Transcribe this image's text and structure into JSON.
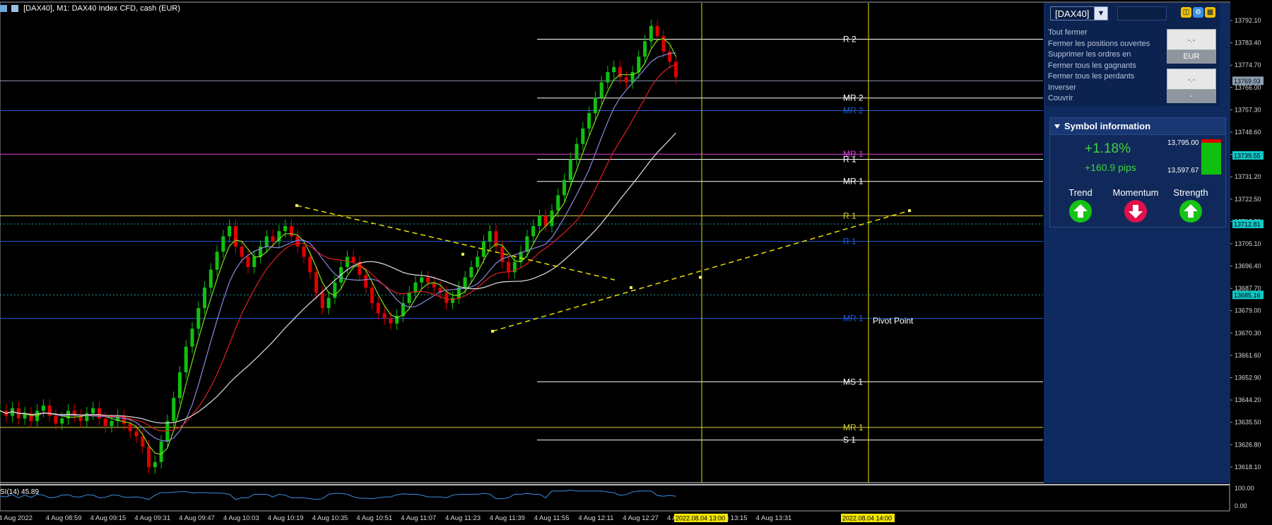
{
  "header": {
    "title": "[DAX40], M1:  DAX40 Index CFD, cash (EUR)"
  },
  "chart_data": {
    "type": "candlestick",
    "symbol": "DAX40",
    "timeframe": "M1",
    "ylim": [
      13612,
      13799
    ],
    "y_ticks": [
      13792.1,
      13783.4,
      13774.7,
      13766.0,
      13757.3,
      13748.6,
      13739.9,
      13731.2,
      13722.5,
      13713.8,
      13705.1,
      13696.4,
      13687.7,
      13679.0,
      13670.3,
      13661.6,
      13652.9,
      13644.2,
      13635.5,
      13626.8,
      13618.1
    ],
    "price_tags": [
      {
        "label": "13769.03",
        "value": 13768.6,
        "color": "#8fa0b4"
      },
      {
        "label": "13739.55",
        "value": 13739.55,
        "color": "#13c8c8"
      },
      {
        "label": "13712.81",
        "value": 13712.81,
        "color": "#13c8c8"
      },
      {
        "label": "13685.16",
        "value": 13685.16,
        "color": "#13c8c8"
      }
    ],
    "x_labels": [
      "4 Aug 2022",
      "4 Aug 08:59",
      "4 Aug 09:15",
      "4 Aug 09:31",
      "4 Aug 09:47",
      "4 Aug 10:03",
      "4 Aug 10:19",
      "4 Aug 10:35",
      "4 Aug 10:51",
      "4 Aug 11:07",
      "4 Aug 11:23",
      "4 Aug 11:39",
      "4 Aug 11:55",
      "4 Aug 12:11",
      "4 Aug 12:27",
      "4 Aug",
      "4 Aug 13:15",
      "4 Aug 13:31"
    ],
    "time_markers": [
      "2022.08.04 13:00",
      "2022.08.04 14:00"
    ],
    "pivot_levels": [
      {
        "name": "R 2",
        "value": 13784.8,
        "color": "#ffffff"
      },
      {
        "name": "MR 2",
        "value": 13761.9,
        "color": "#ffffff"
      },
      {
        "name": "MR 2",
        "value": 13757.0,
        "color": "#1f5bd9"
      },
      {
        "name": "MR 1",
        "value": 13740.0,
        "color": "#e040e0"
      },
      {
        "name": "R 1",
        "value": 13738.0,
        "color": "#ffffff"
      },
      {
        "name": "MR 1",
        "value": 13729.4,
        "color": "#ffffff"
      },
      {
        "name": "R 1",
        "value": 13716.0,
        "color": "#d8d33a"
      },
      {
        "name": "R 1",
        "value": 13706.0,
        "color": "#1f5bd9"
      },
      {
        "name": "MR 1",
        "value": 13676.0,
        "color": "#1f5bd9"
      },
      {
        "name": "MS 1",
        "value": 13651.3,
        "color": "#ffffff"
      },
      {
        "name": "MR 1",
        "value": 13633.5,
        "color": "#d8d33a"
      },
      {
        "name": "S 1",
        "value": 13628.6,
        "color": "#ffffff"
      }
    ],
    "pivot_point_label": "Pivot Point",
    "rsi": {
      "label": "SI(14) 45.89",
      "value": 45.89,
      "ticks": [
        "100.00",
        "0.00"
      ]
    },
    "series_close": [
      13640,
      13638,
      13641,
      13637,
      13639,
      13636,
      13640,
      13642,
      13638,
      13635,
      13637,
      13640,
      13638,
      13636,
      13639,
      13641,
      13637,
      13634,
      13636,
      13638,
      13635,
      13632,
      13630,
      13626,
      13618,
      13620,
      13628,
      13636,
      13645,
      13655,
      13665,
      13672,
      13680,
      13688,
      13695,
      13702,
      13708,
      13712,
      13704,
      13700,
      13696,
      13700,
      13704,
      13708,
      13706,
      13710,
      13712,
      13708,
      13704,
      13700,
      13694,
      13686,
      13680,
      13684,
      13690,
      13696,
      13700,
      13698,
      13693,
      13688,
      13682,
      13678,
      13676,
      13674,
      13677,
      13682,
      13686,
      13690,
      13692,
      13690,
      13688,
      13686,
      13682,
      13684,
      13688,
      13692,
      13696,
      13700,
      13706,
      13710,
      13704,
      13698,
      13694,
      13698,
      13702,
      13708,
      13712,
      13716,
      13712,
      13718,
      13724,
      13730,
      13738,
      13744,
      13750,
      13756,
      13762,
      13768,
      13772,
      13774,
      13770,
      13768,
      13772,
      13778,
      13784,
      13790,
      13786,
      13780,
      13776,
      13770
    ],
    "smart_lines": [
      {
        "from": [
          0.233,
          13720
        ],
        "to": [
          0.372,
          13699
        ],
        "style": "dashed"
      },
      {
        "from": [
          0.372,
          13699
        ],
        "to": [
          0.49,
          13684
        ],
        "style": "dashed"
      },
      {
        "from": [
          0.388,
          13671
        ],
        "to": [
          0.552,
          13696
        ],
        "style": "dashed"
      },
      {
        "from": [
          0.552,
          13696
        ],
        "to": [
          0.717,
          13720
        ],
        "style": "dashed"
      }
    ]
  },
  "trade_panel": {
    "symbol": "[DAX40]",
    "menu": [
      "Tout fermer",
      "Fermer les positions ouvertes",
      "Supprimer les ordres en",
      "Fermer tous les gagnants",
      "Fermer tous les perdants",
      "Inverser",
      "Couvrir"
    ],
    "btn1": "-.-",
    "btn1_sub": "EUR",
    "btn2": "-.-",
    "btn2_sub": "-"
  },
  "symbol_info": {
    "title": "Symbol information",
    "change_pct": "+1.18%",
    "change_pips": "+160.9 pips",
    "high": "13,795.00",
    "low": "13,597.67",
    "trend_label": "Trend",
    "momentum_label": "Momentum",
    "strength_label": "Strength",
    "trend": "up",
    "momentum": "down",
    "strength": "up"
  },
  "colors": {
    "up": "#10c010",
    "down": "#e00000",
    "panel": "#0e2a5e",
    "grid_blue": "#1f3fa8",
    "yellow": "#e8e000"
  }
}
